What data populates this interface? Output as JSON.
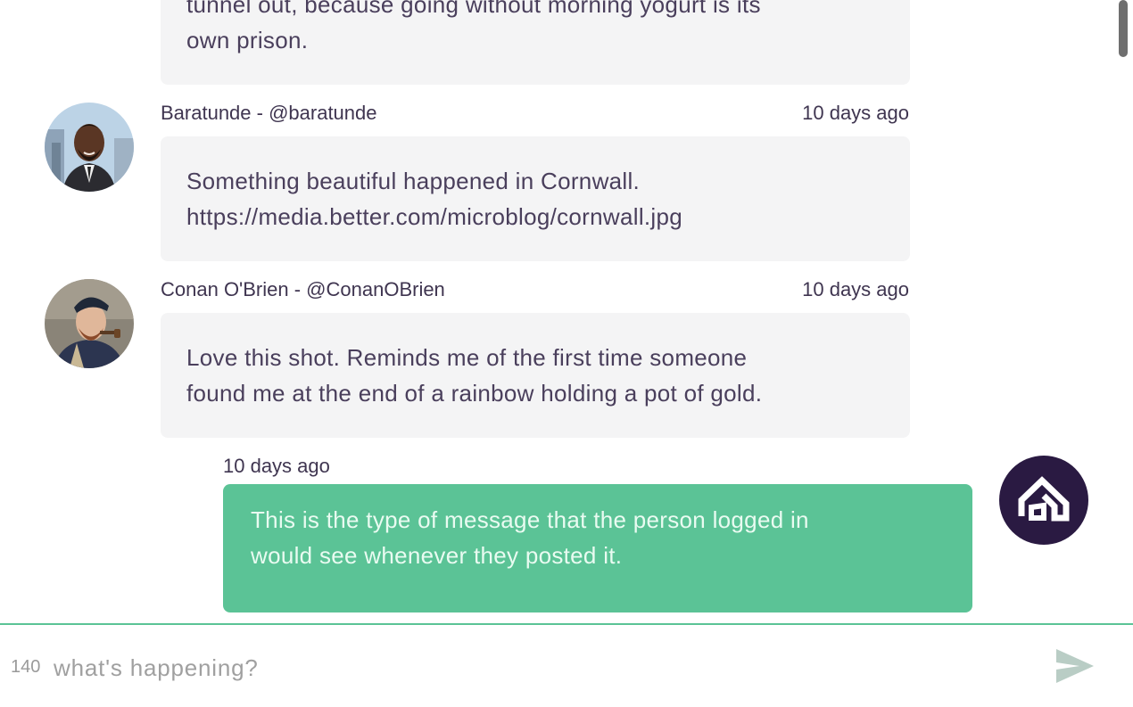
{
  "feed": {
    "partial_message": {
      "lines": [
        "tunnel out, because going without morning yogurt is its",
        "own prison."
      ]
    },
    "messages": [
      {
        "author": "Baratunde - @baratunde",
        "time": "10 days ago",
        "lines": [
          "Something beautiful happened in Cornwall.",
          "https://media.better.com/microblog/cornwall.jpg"
        ]
      },
      {
        "author": "Conan O'Brien - @ConanOBrien",
        "time": "10 days ago",
        "lines": [
          "Love this shot. Reminds me of the first time someone",
          "found me at the end of a rainbow holding a pot of gold."
        ]
      }
    ],
    "own_message": {
      "time": "10 days ago",
      "lines": [
        "This is the type of message that the person logged in",
        "would see whenever they posted it."
      ]
    }
  },
  "composer": {
    "char_count": "140",
    "placeholder": "what's happening?",
    "send_icon": "send-icon"
  },
  "colors": {
    "own_bubble": "#5bc396",
    "other_bubble": "#f4f4f5",
    "text": "#3f3550",
    "own_avatar_bg": "#2a1a42"
  }
}
